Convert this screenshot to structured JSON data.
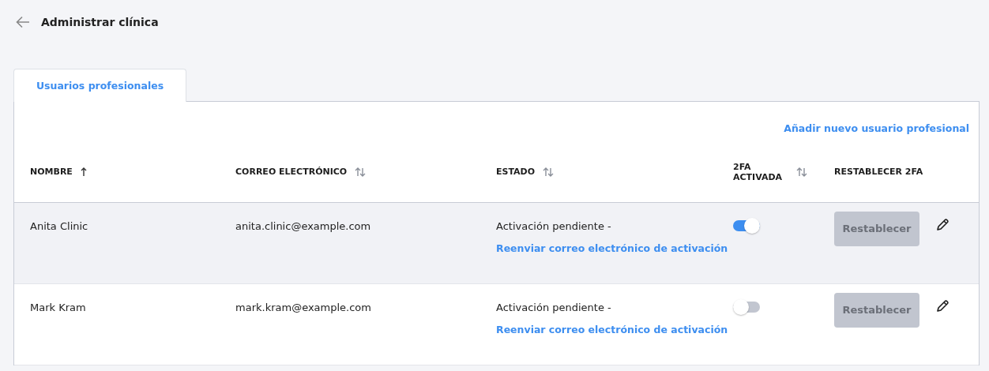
{
  "header": {
    "title": "Administrar clínica"
  },
  "tabs": [
    {
      "label": "Usuarios profesionales",
      "selected": true
    }
  ],
  "add_link": "Añadir nuevo usuario profesional",
  "table": {
    "columns": [
      {
        "label": "NOMBRE",
        "sorted": true
      },
      {
        "label": "CORREO ELECTRÓNICO",
        "sorted": false
      },
      {
        "label": "ESTADO",
        "sorted": false
      },
      {
        "label": "2FA ACTIVADA",
        "sorted": false
      },
      {
        "label": "RESTABLECER 2FA"
      }
    ],
    "rows": [
      {
        "name": "Anita Clinic",
        "email": "anita.clinic@example.com",
        "status": "Activación pendiente -",
        "resend_link": "Reenviar correo electrónico de activación",
        "two_fa": true,
        "reset_button": "Restablecer",
        "reset_disabled": true,
        "highlighted": true
      },
      {
        "name": "Mark Kram",
        "email": "mark.kram@example.com",
        "status": "Activación pendiente -",
        "resend_link": "Reenviar correo electrónico de activación",
        "two_fa": false,
        "reset_button": "Restablecer",
        "reset_disabled": true,
        "highlighted": false
      }
    ]
  }
}
